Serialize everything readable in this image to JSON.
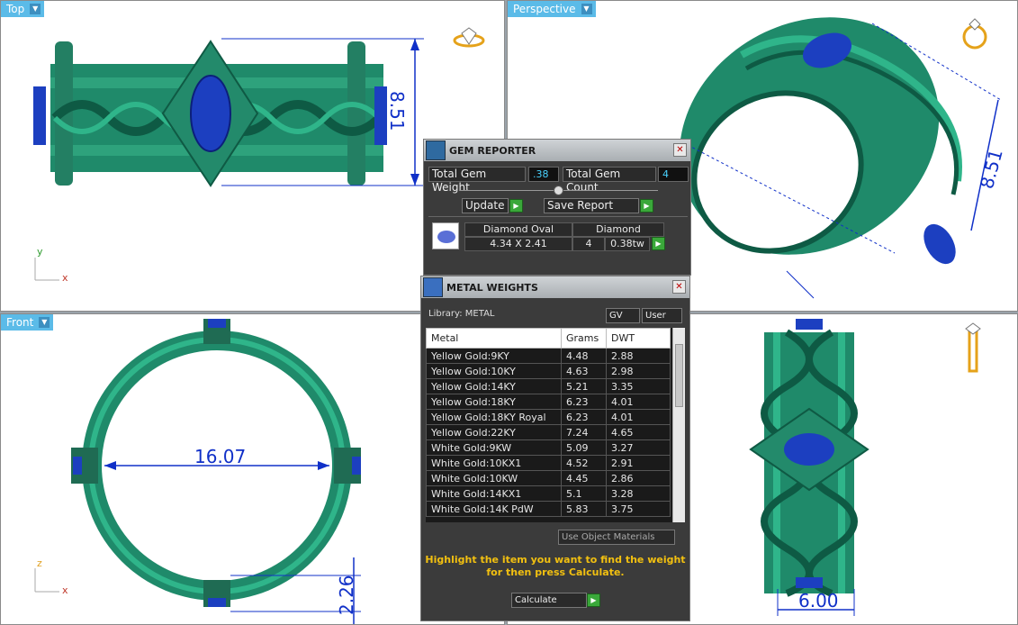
{
  "viewports": {
    "top": {
      "label": "Top",
      "axis_y": "y",
      "axis_x": "x",
      "dim": "8.51"
    },
    "perspective": {
      "label": "Perspective",
      "dim": "8.51"
    },
    "front": {
      "label": "Front",
      "axis_y": "z",
      "axis_x": "x",
      "dim_width": "16.07",
      "dim_height": "2.26"
    },
    "right": {
      "dim": "6.00"
    }
  },
  "gem_reporter": {
    "title": "GEM REPORTER",
    "total_weight_label": "Total Gem Weight",
    "total_weight_value": ".38",
    "total_count_label": "Total Gem Count",
    "total_count_value": "4",
    "update_label": "Update",
    "save_report_label": "Save Report",
    "gem": {
      "name": "Diamond Oval",
      "size": "4.34 X 2.41",
      "material": "Diamond",
      "count": "4",
      "weight": "0.38tw"
    }
  },
  "metal_weights": {
    "title": "METAL WEIGHTS",
    "library_label": "Library: METAL",
    "gv_label": "GV",
    "user_label": "User",
    "columns": [
      "Metal",
      "Grams",
      "DWT"
    ],
    "rows": [
      [
        "Yellow Gold:9KY",
        "4.48",
        "2.88"
      ],
      [
        "Yellow Gold:10KY",
        "4.63",
        "2.98"
      ],
      [
        "Yellow Gold:14KY",
        "5.21",
        "3.35"
      ],
      [
        "Yellow Gold:18KY",
        "6.23",
        "4.01"
      ],
      [
        "Yellow Gold:18KY Royal",
        "6.23",
        "4.01"
      ],
      [
        "Yellow Gold:22KY",
        "7.24",
        "4.65"
      ],
      [
        "White Gold:9KW",
        "5.09",
        "3.27"
      ],
      [
        "White Gold:10KX1",
        "4.52",
        "2.91"
      ],
      [
        "White Gold:10KW",
        "4.45",
        "2.86"
      ],
      [
        "White Gold:14KX1",
        "5.1",
        "3.28"
      ],
      [
        "White Gold:14K PdW",
        "5.83",
        "3.75"
      ]
    ],
    "use_object_materials_label": "Use Object Materials",
    "hint": "Highlight the item you want to find the weight for then press Calculate.",
    "calculate_label": "Calculate"
  },
  "colors": {
    "ring": "#1f8a6a",
    "gem": "#1c3fc0",
    "dimension": "#1030c8",
    "tab": "#5bbbe8"
  }
}
